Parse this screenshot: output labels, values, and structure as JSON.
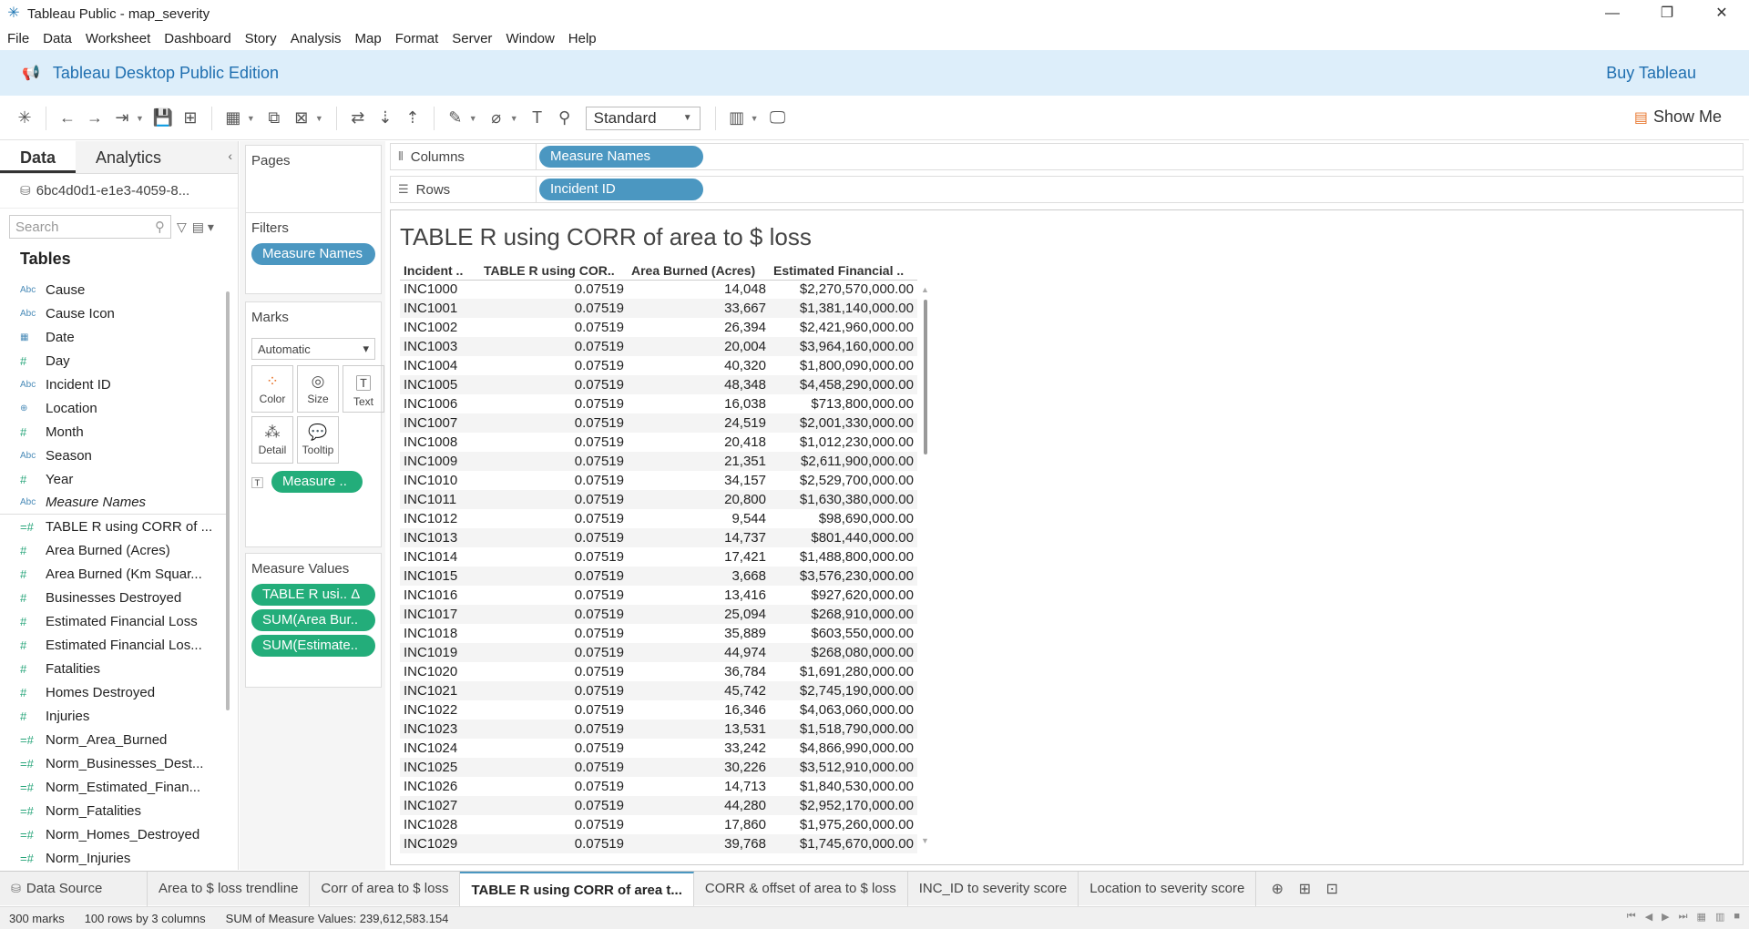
{
  "window": {
    "title": "Tableau Public - map_severity",
    "controls": [
      "—",
      "❐",
      "✕"
    ]
  },
  "menu": [
    "File",
    "Data",
    "Worksheet",
    "Dashboard",
    "Story",
    "Analysis",
    "Map",
    "Format",
    "Server",
    "Window",
    "Help"
  ],
  "banner": {
    "edition": "Tableau Desktop Public Edition",
    "buy": "Buy Tableau"
  },
  "toolbar": {
    "fit_select": "Standard",
    "show_me": "Show Me"
  },
  "data_pane": {
    "tabs": [
      "Data",
      "Analytics"
    ],
    "datasource": "6bc4d0d1-e1e3-4059-8...",
    "search_placeholder": "Search",
    "tables_label": "Tables",
    "fields": [
      {
        "type": "Abc",
        "name": "Cause"
      },
      {
        "type": "Abc",
        "name": "Cause Icon"
      },
      {
        "type": "date",
        "name": "Date"
      },
      {
        "type": "#",
        "name": "Day"
      },
      {
        "type": "Abc",
        "name": "Incident ID"
      },
      {
        "type": "geo",
        "name": "Location"
      },
      {
        "type": "#",
        "name": "Month"
      },
      {
        "type": "Abc",
        "name": "Season"
      },
      {
        "type": "#",
        "name": "Year"
      },
      {
        "type": "Abc",
        "name": "Measure Names"
      },
      {
        "type": "=#",
        "name": "TABLE R using CORR of ..."
      },
      {
        "type": "#",
        "name": "Area Burned (Acres)"
      },
      {
        "type": "#",
        "name": "Area Burned (Km Squar..."
      },
      {
        "type": "#",
        "name": "Businesses Destroyed"
      },
      {
        "type": "#",
        "name": "Estimated Financial Loss"
      },
      {
        "type": "#",
        "name": "Estimated Financial Los..."
      },
      {
        "type": "#",
        "name": "Fatalities"
      },
      {
        "type": "#",
        "name": "Homes Destroyed"
      },
      {
        "type": "#",
        "name": "Injuries"
      },
      {
        "type": "=#",
        "name": "Norm_Area_Burned"
      },
      {
        "type": "=#",
        "name": "Norm_Businesses_Dest..."
      },
      {
        "type": "=#",
        "name": "Norm_Estimated_Finan..."
      },
      {
        "type": "=#",
        "name": "Norm_Fatalities"
      },
      {
        "type": "=#",
        "name": "Norm_Homes_Destroyed"
      },
      {
        "type": "=#",
        "name": "Norm_Injuries"
      }
    ]
  },
  "cards": {
    "pages": "Pages",
    "filters": "Filters",
    "filter_pill": "Measure Names",
    "marks": "Marks",
    "mark_type": "Automatic",
    "mark_buttons": [
      "Color",
      "Size",
      "Text",
      "Detail",
      "Tooltip"
    ],
    "marks_pill": "Measure ..",
    "measure_values": "Measure Values",
    "measure_pills": [
      "TABLE R usi..  Δ",
      "SUM(Area Bur..",
      "SUM(Estimate.."
    ]
  },
  "shelves": {
    "columns_label": "Columns",
    "columns_pill": "Measure Names",
    "rows_label": "Rows",
    "rows_pill": "Incident ID"
  },
  "view": {
    "title": "TABLE R using CORR of area to $ loss",
    "headers": [
      "Incident ..",
      "TABLE R using COR..",
      "Area Burned (Acres)",
      "Estimated Financial .."
    ],
    "rows": [
      [
        "INC1000",
        "0.07519",
        "14,048",
        "$2,270,570,000.00"
      ],
      [
        "INC1001",
        "0.07519",
        "33,667",
        "$1,381,140,000.00"
      ],
      [
        "INC1002",
        "0.07519",
        "26,394",
        "$2,421,960,000.00"
      ],
      [
        "INC1003",
        "0.07519",
        "20,004",
        "$3,964,160,000.00"
      ],
      [
        "INC1004",
        "0.07519",
        "40,320",
        "$1,800,090,000.00"
      ],
      [
        "INC1005",
        "0.07519",
        "48,348",
        "$4,458,290,000.00"
      ],
      [
        "INC1006",
        "0.07519",
        "16,038",
        "$713,800,000.00"
      ],
      [
        "INC1007",
        "0.07519",
        "24,519",
        "$2,001,330,000.00"
      ],
      [
        "INC1008",
        "0.07519",
        "20,418",
        "$1,012,230,000.00"
      ],
      [
        "INC1009",
        "0.07519",
        "21,351",
        "$2,611,900,000.00"
      ],
      [
        "INC1010",
        "0.07519",
        "34,157",
        "$2,529,700,000.00"
      ],
      [
        "INC1011",
        "0.07519",
        "20,800",
        "$1,630,380,000.00"
      ],
      [
        "INC1012",
        "0.07519",
        "9,544",
        "$98,690,000.00"
      ],
      [
        "INC1013",
        "0.07519",
        "14,737",
        "$801,440,000.00"
      ],
      [
        "INC1014",
        "0.07519",
        "17,421",
        "$1,488,800,000.00"
      ],
      [
        "INC1015",
        "0.07519",
        "3,668",
        "$3,576,230,000.00"
      ],
      [
        "INC1016",
        "0.07519",
        "13,416",
        "$927,620,000.00"
      ],
      [
        "INC1017",
        "0.07519",
        "25,094",
        "$268,910,000.00"
      ],
      [
        "INC1018",
        "0.07519",
        "35,889",
        "$603,550,000.00"
      ],
      [
        "INC1019",
        "0.07519",
        "44,974",
        "$268,080,000.00"
      ],
      [
        "INC1020",
        "0.07519",
        "36,784",
        "$1,691,280,000.00"
      ],
      [
        "INC1021",
        "0.07519",
        "45,742",
        "$2,745,190,000.00"
      ],
      [
        "INC1022",
        "0.07519",
        "16,346",
        "$4,063,060,000.00"
      ],
      [
        "INC1023",
        "0.07519",
        "13,531",
        "$1,518,790,000.00"
      ],
      [
        "INC1024",
        "0.07519",
        "33,242",
        "$4,866,990,000.00"
      ],
      [
        "INC1025",
        "0.07519",
        "30,226",
        "$3,512,910,000.00"
      ],
      [
        "INC1026",
        "0.07519",
        "14,713",
        "$1,840,530,000.00"
      ],
      [
        "INC1027",
        "0.07519",
        "44,280",
        "$2,952,170,000.00"
      ],
      [
        "INC1028",
        "0.07519",
        "17,860",
        "$1,975,260,000.00"
      ],
      [
        "INC1029",
        "0.07519",
        "39,768",
        "$1,745,670,000.00"
      ]
    ]
  },
  "sheet_tabs": {
    "data_source": "Data Source",
    "sheets": [
      {
        "label": "Area to $ loss trendline",
        "active": false
      },
      {
        "label": "Corr of area to $ loss",
        "active": false
      },
      {
        "label": "TABLE R using CORR of area t...",
        "active": true
      },
      {
        "label": "CORR & offset of area to $ loss",
        "active": false
      },
      {
        "label": "INC_ID to severity score",
        "active": false
      },
      {
        "label": "Location to severity score",
        "active": false
      }
    ]
  },
  "status": {
    "marks": "300 marks",
    "dims": "100 rows by 3 columns",
    "sum": "SUM of Measure Values: 239,612,583.154"
  },
  "colors": {
    "pill_blue": "#4b97c1",
    "pill_green": "#23ad7a",
    "banner_bg": "#ddeefa",
    "accent_link": "#1f6fb0"
  }
}
